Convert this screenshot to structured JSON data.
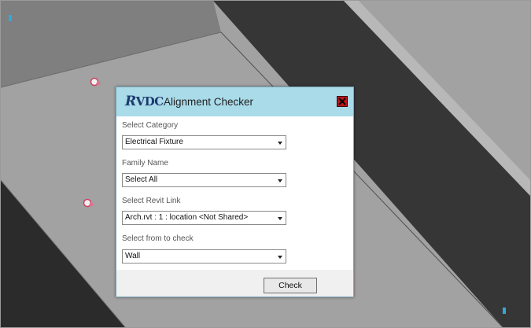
{
  "dialog": {
    "logo": "VDC",
    "title": "Alignment Checker",
    "fields": [
      {
        "label": "Select Category",
        "value": "Electrical Fixture"
      },
      {
        "label": "Family Name",
        "value": "Select All"
      },
      {
        "label": "Select Revit Link",
        "value": "Arch.rvt : 1 : location <Not Shared>"
      },
      {
        "label": "Select from to check",
        "value": "Wall"
      }
    ],
    "check_label": "Check"
  },
  "colors": {
    "titlebar": "#a9dbe9",
    "close": "#c0141b",
    "floor_gray": "#a2a2a2",
    "wall_dark": "#363636",
    "top_left_gray": "#7f7f7f"
  },
  "icons": [
    "close-icon",
    "element-marker-icon",
    "grid-marker-icon"
  ]
}
